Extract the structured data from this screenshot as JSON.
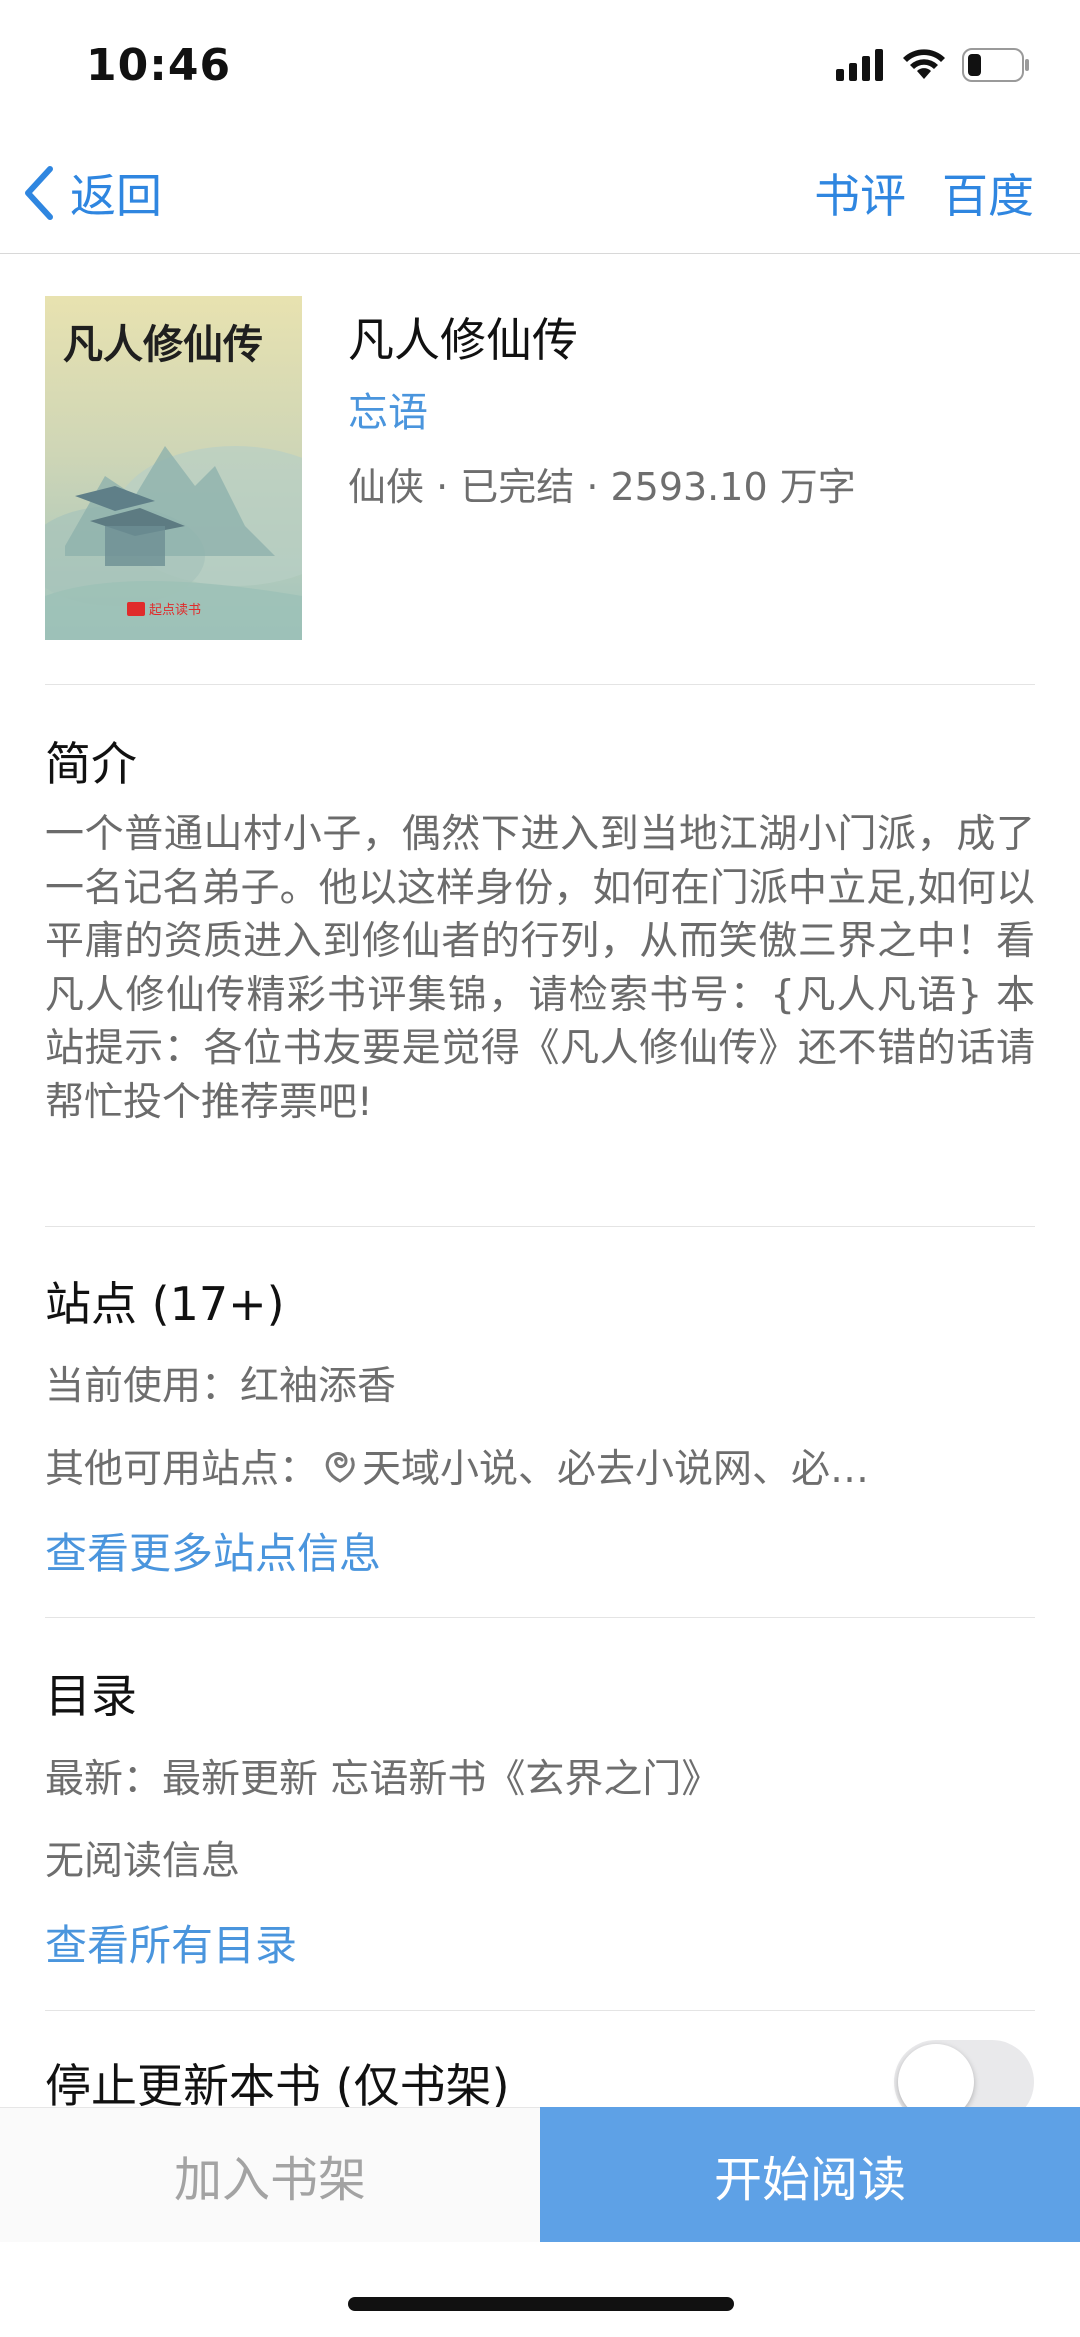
{
  "status_bar": {
    "time": "10:46"
  },
  "nav": {
    "back_label": "返回",
    "review_label": "书评",
    "baidu_label": "百度"
  },
  "book": {
    "title": "凡人修仙传",
    "author": "忘语",
    "meta": "仙侠 · 已完结 · 2593.10 万字",
    "cover_title": "凡人修仙传",
    "cover_publisher": "起点读书"
  },
  "intro": {
    "title": "简介",
    "text": "一个普通山村小子，偶然下进入到当地江湖小门派，成了一名记名弟子。他以这样身份，如何在门派中立足,如何以平庸的资质进入到修仙者的行列，从而笑傲三界之中！看凡人修仙传精彩书评集锦，请检索书号：{凡人凡语} 本站提示：各位书友要是觉得《凡人修仙传》还不错的话请帮忙投个推荐票吧!"
  },
  "sites": {
    "title": "站点 (17+)",
    "current": "当前使用：红袖添香",
    "others_label": "其他可用站点：",
    "others_list": "天域小说、必去小说网、必…",
    "more_link": "查看更多站点信息"
  },
  "catalog": {
    "title": "目录",
    "latest": "最新：最新更新  忘语新书《玄界之门》",
    "read_info": "无阅读信息",
    "all_link": "查看所有目录"
  },
  "stop_update": {
    "label": "停止更新本书 (仅书架)",
    "enabled": false
  },
  "actions": {
    "add_shelf": "加入书架",
    "start_reading": "开始阅读"
  },
  "colors": {
    "accent": "#2f86e0",
    "link": "#4a95dd",
    "read_button": "#5ea1e6",
    "muted_text": "#6e6e6e"
  }
}
